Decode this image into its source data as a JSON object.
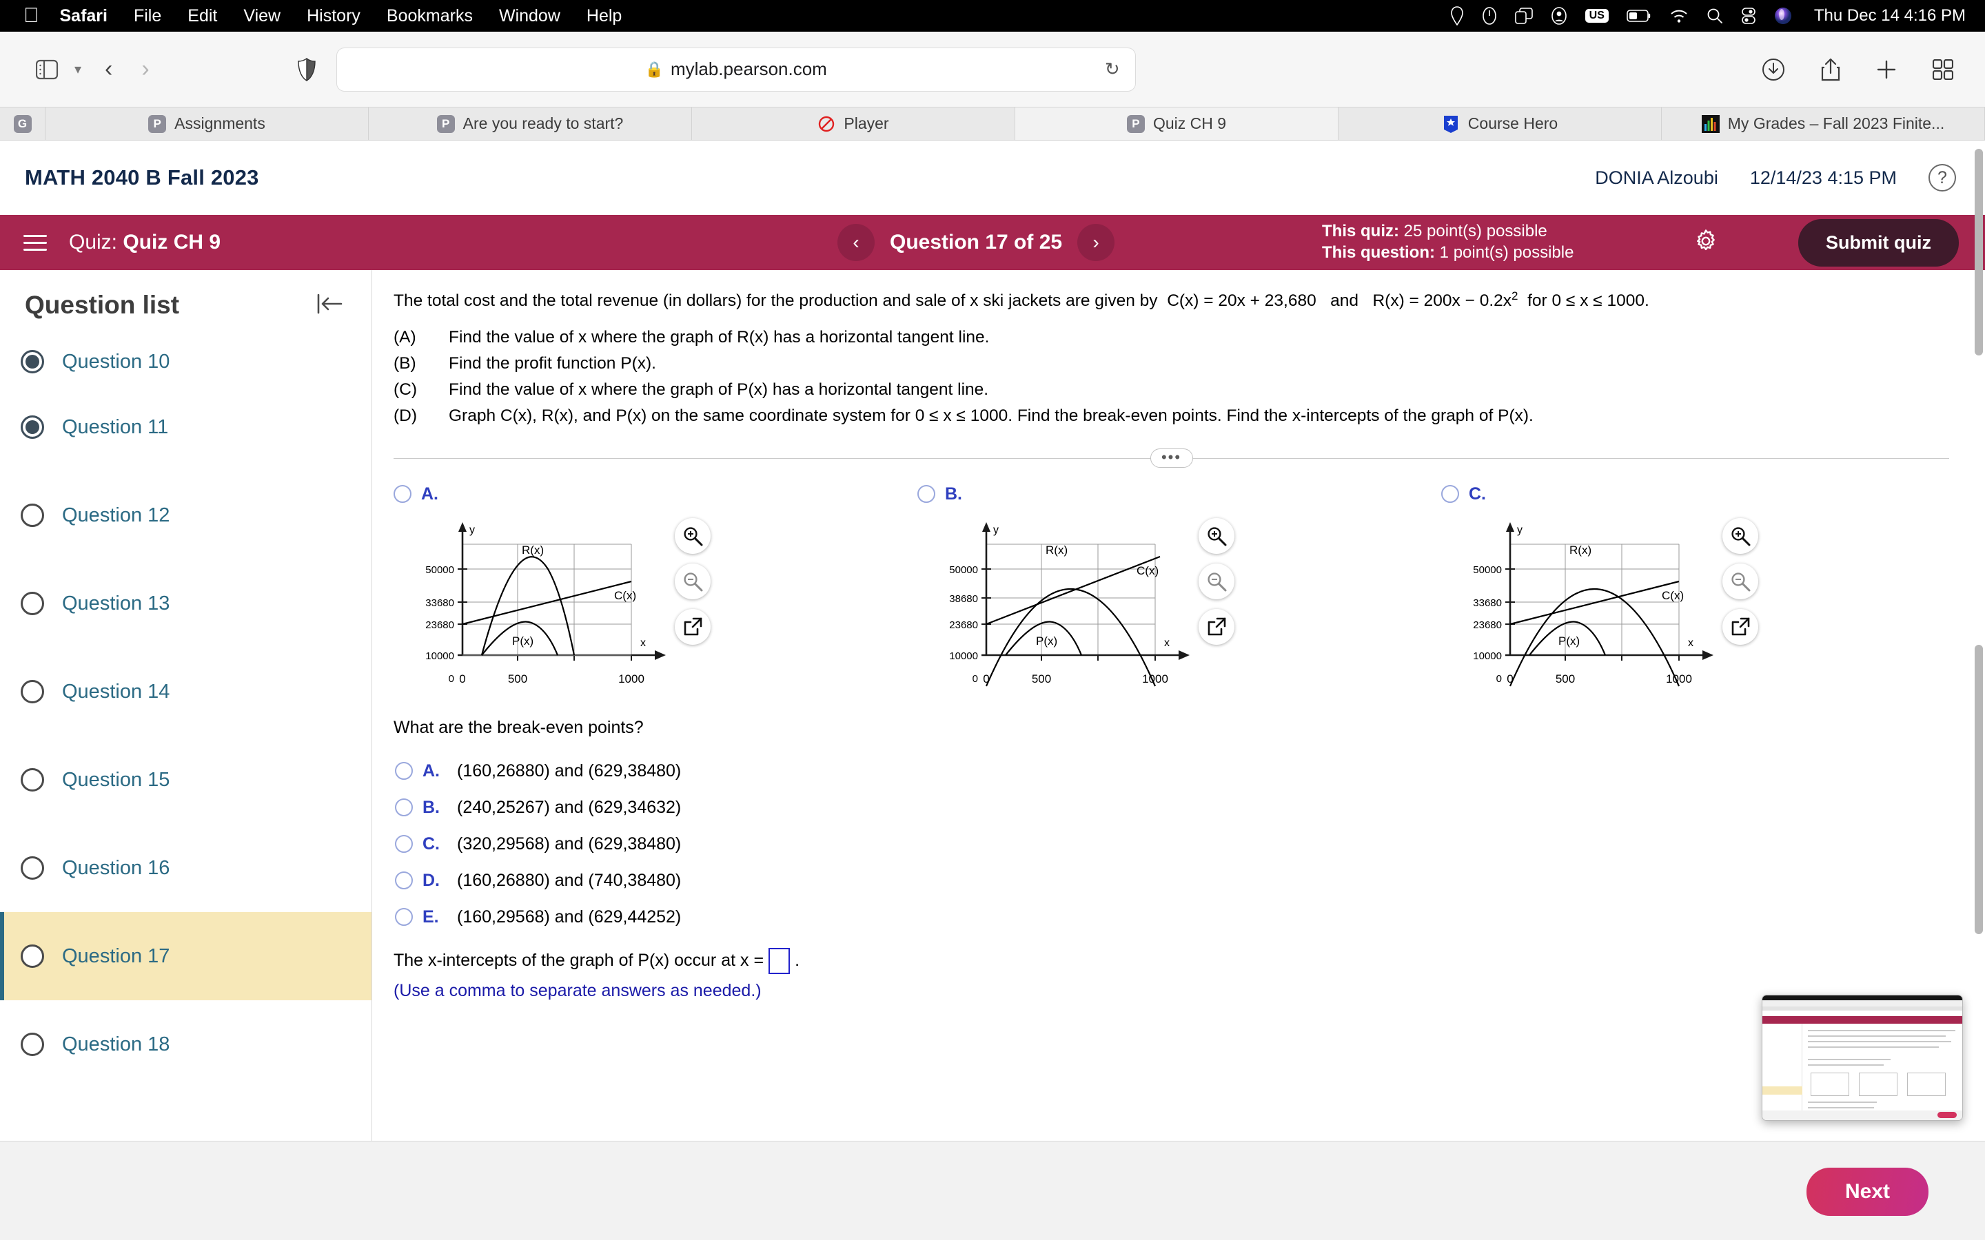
{
  "macos": {
    "app_name": "Safari",
    "menus": [
      "File",
      "Edit",
      "View",
      "History",
      "Bookmarks",
      "Window",
      "Help"
    ],
    "status_icons": [
      "location-icon",
      "clock-icon",
      "screen-mirroring-icon",
      "user-account-icon",
      "input-source-us",
      "battery-icon",
      "wifi-icon",
      "spotlight-search-icon",
      "control-center-icon",
      "siri-icon"
    ],
    "input_source": "US",
    "clock": "Thu Dec 14  4:16 PM"
  },
  "safari": {
    "url": "mylab.pearson.com",
    "lock_icon": "lock-icon",
    "toolbar_icons": [
      "sidebar-icon",
      "chevron-down-icon",
      "back-icon",
      "forward-icon",
      "shield-icon",
      "reload-icon",
      "downloads-icon",
      "share-icon",
      "new-tab-icon",
      "tab-overview-icon"
    ],
    "tabs": [
      {
        "label": "",
        "icon": "grammarly-favicon",
        "icon_letter": "G",
        "active": false
      },
      {
        "label": "Assignments",
        "icon": "pearson-favicon",
        "icon_letter": "P",
        "active": false
      },
      {
        "label": "Are you ready to start?",
        "icon": "pearson-favicon",
        "icon_letter": "P",
        "active": false
      },
      {
        "label": "Player",
        "icon": "player-favicon",
        "icon_letter": "",
        "active": false
      },
      {
        "label": "Quiz CH 9",
        "icon": "pearson-favicon",
        "icon_letter": "P",
        "active": true
      },
      {
        "label": "Course Hero",
        "icon": "coursehero-favicon",
        "icon_letter": "",
        "active": false
      },
      {
        "label": "My Grades – Fall 2023 Finite...",
        "icon": "mygrades-favicon",
        "icon_letter": "",
        "active": false
      }
    ]
  },
  "course_header": {
    "title": "MATH 2040 B Fall 2023",
    "user": "DONIA Alzoubi",
    "timestamp": "12/14/23 4:15 PM",
    "help_label": "?"
  },
  "quiz_bar": {
    "prefix": "Quiz:",
    "name": "Quiz CH 9",
    "prev_label": "‹",
    "next_label": "›",
    "question_counter": "Question 17 of 25",
    "quiz_points_label": "This quiz:",
    "quiz_points_value": "25 point(s) possible",
    "question_points_label": "This question:",
    "question_points_value": "1 point(s) possible",
    "settings_icon": "gear-icon",
    "submit_label": "Submit quiz",
    "accent_color": "#a6264f",
    "submit_color": "#3f1a2b"
  },
  "sidebar": {
    "title": "Question list",
    "collapse_icon": "collapse-left-icon",
    "items": [
      {
        "label": "Question 10",
        "answered": true,
        "current": false
      },
      {
        "label": "Question 11",
        "answered": true,
        "current": false
      },
      {
        "label": "Question 12",
        "answered": false,
        "current": false
      },
      {
        "label": "Question 13",
        "answered": false,
        "current": false
      },
      {
        "label": "Question 14",
        "answered": false,
        "current": false
      },
      {
        "label": "Question 15",
        "answered": false,
        "current": false
      },
      {
        "label": "Question 16",
        "answered": false,
        "current": false
      },
      {
        "label": "Question 17",
        "answered": false,
        "current": true
      },
      {
        "label": "Question 18",
        "answered": false,
        "current": false
      }
    ],
    "highlight_color": "#f7e8b8",
    "link_color": "#2b6a84"
  },
  "question": {
    "stem_before": "The total cost and the total revenue (in dollars) for the production and sale of x ski jackets are given by",
    "formula_c": "C(x) = 20x + 23,680",
    "formula_and": "and",
    "formula_r_base": "R(x) = 200x − 0.2x",
    "formula_r_exp": "2",
    "formula_domain": "for 0 ≤ x ≤ 1000.",
    "parts": [
      {
        "tag": "(A)",
        "text": "Find the value of x where the graph of R(x) has a horizontal tangent line."
      },
      {
        "tag": "(B)",
        "text": "Find the profit function P(x)."
      },
      {
        "tag": "(C)",
        "text": "Find the value of x where the graph of P(x) has a horizontal tangent line."
      },
      {
        "tag": "(D)",
        "text": "Graph C(x), R(x), and P(x) on the same coordinate system for 0 ≤ x ≤ 1000. Find the break-even points. Find the x-intercepts of the graph of P(x)."
      }
    ],
    "divider_label": "•••",
    "break_even_prompt": "What are the break-even points?",
    "x_intercept_prompt_before": "The x-intercepts of the graph of P(x) occur at x =",
    "x_intercept_prompt_after": ".",
    "x_intercept_value": "",
    "x_intercept_hint": "(Use a comma to separate answers as needed.)"
  },
  "graph_choices": [
    {
      "letter": "A.",
      "selected": false,
      "tools": [
        "zoom-in-icon",
        "zoom-out-icon",
        "open-external-icon"
      ]
    },
    {
      "letter": "B.",
      "selected": false,
      "tools": [
        "zoom-in-icon",
        "zoom-out-icon",
        "open-external-icon"
      ]
    },
    {
      "letter": "C.",
      "selected": false,
      "tools": [
        "zoom-in-icon",
        "zoom-out-icon",
        "open-external-icon"
      ]
    }
  ],
  "answer_options": [
    {
      "letter": "A.",
      "text": "(160,26880) and (629,38480)",
      "selected": false
    },
    {
      "letter": "B.",
      "text": "(240,25267) and (629,34632)",
      "selected": false
    },
    {
      "letter": "C.",
      "text": "(320,29568) and (629,38480)",
      "selected": false
    },
    {
      "letter": "D.",
      "text": "(160,26880) and (740,38480)",
      "selected": false
    },
    {
      "letter": "E.",
      "text": "(160,29568) and (629,44252)",
      "selected": false
    }
  ],
  "footer": {
    "next_label": "Next"
  },
  "chart_data": [
    {
      "type": "line",
      "id": "choice-a",
      "title": "A.",
      "xlabel": "x",
      "ylabel": "y",
      "xlim": [
        0,
        1100
      ],
      "ylim": [
        0,
        57000
      ],
      "xticks": [
        0,
        500,
        1000
      ],
      "xtick_labels": [
        "0",
        "500",
        "1000"
      ],
      "yticks": [
        0,
        10000,
        23680,
        33680,
        50000
      ],
      "ytick_labels": [
        "0",
        "10000",
        "23680",
        "33680",
        "50000"
      ],
      "grid": true,
      "series": [
        {
          "name": "R(x)",
          "shape": "parabola",
          "vertex": [
            500,
            50000
          ],
          "x_range": [
            170,
            840
          ],
          "label_at": [
            500,
            53000
          ]
        },
        {
          "name": "C(x)",
          "shape": "line",
          "intercept": 23680,
          "points": [
            [
              0,
              23680
            ],
            [
              1000,
              43680
            ]
          ],
          "label_at": [
            1000,
            41000
          ]
        },
        {
          "name": "P(x)",
          "shape": "parabola",
          "vertex": [
            460,
            16000
          ],
          "x_range": [
            170,
            750
          ],
          "label_at": [
            440,
            10500
          ]
        }
      ]
    },
    {
      "type": "line",
      "id": "choice-b",
      "title": "B.",
      "xlabel": "x",
      "ylabel": "y",
      "xlim": [
        0,
        1100
      ],
      "ylim": [
        0,
        57000
      ],
      "xticks": [
        0,
        500,
        1000
      ],
      "xtick_labels": [
        "0",
        "500",
        "1000"
      ],
      "yticks": [
        0,
        10000,
        23680,
        38680,
        50000
      ],
      "ytick_labels": [
        "0",
        "10000",
        "23680",
        "38680",
        "50000"
      ],
      "grid": true,
      "series": [
        {
          "name": "R(x)",
          "shape": "parabola",
          "vertex": [
            500,
            50000
          ],
          "x_range": [
            0,
            1000
          ],
          "label_at": [
            500,
            53000
          ]
        },
        {
          "name": "C(x)",
          "shape": "line",
          "intercept": 23680,
          "points": [
            [
              0,
              23680
            ],
            [
              1000,
              53680
            ]
          ],
          "label_at": [
            1000,
            50000
          ]
        },
        {
          "name": "P(x)",
          "shape": "parabola",
          "vertex": [
            460,
            16000
          ],
          "x_range": [
            170,
            750
          ],
          "label_at": [
            440,
            10500
          ]
        }
      ]
    },
    {
      "type": "line",
      "id": "choice-c",
      "title": "C.",
      "xlabel": "x",
      "ylabel": "y",
      "xlim": [
        0,
        1100
      ],
      "ylim": [
        0,
        57000
      ],
      "xticks": [
        0,
        500,
        1000
      ],
      "xtick_labels": [
        "0",
        "500",
        "1000"
      ],
      "yticks": [
        0,
        10000,
        23680,
        33680,
        50000
      ],
      "ytick_labels": [
        "0",
        "10000",
        "23680",
        "33680",
        "50000"
      ],
      "grid": true,
      "series": [
        {
          "name": "R(x)",
          "shape": "parabola",
          "vertex": [
            500,
            50000
          ],
          "x_range": [
            0,
            1000
          ],
          "label_at": [
            500,
            53000
          ]
        },
        {
          "name": "C(x)",
          "shape": "line",
          "intercept": 23680,
          "points": [
            [
              0,
              23680
            ],
            [
              1000,
              43680
            ]
          ],
          "label_at": [
            1000,
            41000
          ]
        },
        {
          "name": "P(x)",
          "shape": "parabola",
          "vertex": [
            460,
            16000
          ],
          "x_range": [
            170,
            750
          ],
          "label_at": [
            440,
            10500
          ]
        }
      ]
    }
  ]
}
